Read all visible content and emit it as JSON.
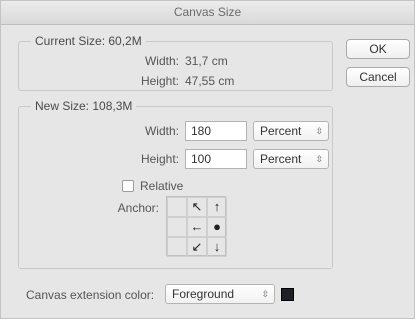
{
  "window": {
    "title": "Canvas Size"
  },
  "current": {
    "title": "Current Size: 60,2M",
    "width_label": "Width:",
    "width_value": "31,7 cm",
    "height_label": "Height:",
    "height_value": "47,55 cm"
  },
  "new_size": {
    "title": "New Size: 108,3M",
    "width_label": "Width:",
    "width_value": "180",
    "width_unit": "Percent",
    "height_label": "Height:",
    "height_value": "100",
    "height_unit": "Percent",
    "relative_label": "Relative",
    "relative_checked": false,
    "anchor_label": "Anchor:",
    "anchor_cells": [
      "",
      "↖",
      "↑",
      "",
      "←",
      "●",
      "",
      "↙",
      "↓"
    ]
  },
  "buttons": {
    "ok": "OK",
    "cancel": "Cancel"
  },
  "extension": {
    "label": "Canvas extension color:",
    "value": "Foreground",
    "swatch_color": "#1c2127"
  }
}
